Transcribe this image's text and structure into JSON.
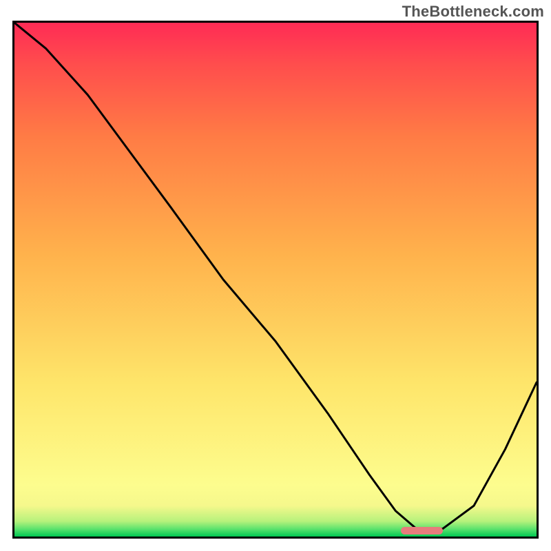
{
  "watermark": "TheBottleneck.com",
  "chart_data": {
    "type": "line",
    "title": "",
    "xlabel": "",
    "ylabel": "",
    "xlim": [
      0,
      100
    ],
    "ylim": [
      0,
      100
    ],
    "gradient_stops": [
      {
        "offset": 0.0,
        "color": "#00c853"
      },
      {
        "offset": 0.015,
        "color": "#5de36e"
      },
      {
        "offset": 0.03,
        "color": "#b7f27c"
      },
      {
        "offset": 0.06,
        "color": "#f5f88c"
      },
      {
        "offset": 0.1,
        "color": "#fdfd8e"
      },
      {
        "offset": 0.3,
        "color": "#fee56a"
      },
      {
        "offset": 0.55,
        "color": "#ffb24c"
      },
      {
        "offset": 0.78,
        "color": "#ff7b45"
      },
      {
        "offset": 0.92,
        "color": "#ff4d4d"
      },
      {
        "offset": 1.0,
        "color": "#ff2b55"
      }
    ],
    "series": [
      {
        "name": "curve",
        "x": [
          0,
          6,
          14,
          22,
          30,
          40,
          50,
          60,
          68,
          73,
          77,
          82,
          88,
          94,
          100
        ],
        "y": [
          100,
          95,
          86,
          75,
          64,
          50,
          38,
          24,
          12,
          5,
          1.5,
          1.5,
          6,
          17,
          30
        ]
      }
    ],
    "marker": {
      "x_start": 74,
      "x_end": 82,
      "y": 1.2,
      "color": "#e77c7c"
    }
  }
}
